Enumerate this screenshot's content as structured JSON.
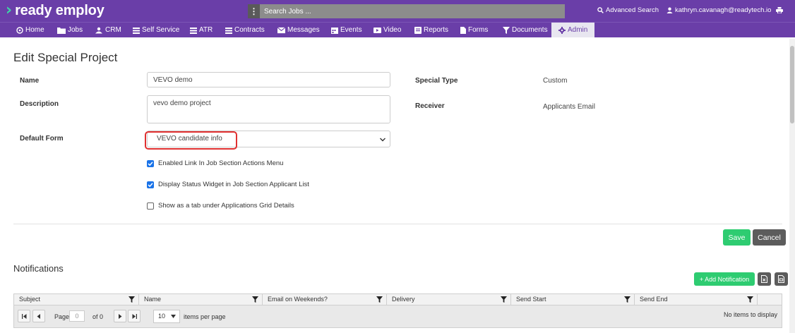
{
  "app": {
    "logo_text": "ready employ",
    "search_placeholder": "Search Jobs ...",
    "advanced_search": "Advanced Search",
    "user_email": "kathryn.cavanagh@readytech.io",
    "brand_color": "#6a3ea8",
    "accent_color": "#3fd6a6"
  },
  "nav": {
    "items": [
      {
        "label": "Home",
        "icon": "home-icon"
      },
      {
        "label": "Jobs",
        "icon": "folder-icon"
      },
      {
        "label": "CRM",
        "icon": "users-icon"
      },
      {
        "label": "Self Service",
        "icon": "list-icon"
      },
      {
        "label": "ATR",
        "icon": "list-icon"
      },
      {
        "label": "Contracts",
        "icon": "list-icon"
      },
      {
        "label": "Messages",
        "icon": "envelope-icon"
      },
      {
        "label": "Events",
        "icon": "calendar-icon"
      },
      {
        "label": "Video",
        "icon": "video-icon"
      },
      {
        "label": "Reports",
        "icon": "report-icon"
      },
      {
        "label": "Forms",
        "icon": "file-icon"
      },
      {
        "label": "Documents",
        "icon": "filter-icon"
      },
      {
        "label": "Admin",
        "icon": "gear-icon",
        "active": true
      }
    ]
  },
  "form": {
    "title": "Edit Special Project",
    "name_label": "Name",
    "name_value": "VEVO demo",
    "description_label": "Description",
    "description_value": "vevo demo project",
    "default_form_label": "Default Form",
    "default_form_value": "VEVO candidate info",
    "special_type_label": "Special Type",
    "special_type_value": "Custom",
    "receiver_label": "Receiver",
    "receiver_value": "Applicants Email",
    "checkboxes": [
      {
        "label": "Enabled Link In Job Section Actions Menu",
        "checked": true
      },
      {
        "label": "Display Status Widget in Job Section Applicant List",
        "checked": true
      },
      {
        "label": "Show as a tab under Applications Grid Details",
        "checked": false
      }
    ],
    "save_label": "Save",
    "cancel_label": "Cancel"
  },
  "notifications": {
    "title": "Notifications",
    "add_label": "+ Add Notification",
    "columns": [
      "Subject",
      "Name",
      "Email on Weekends?",
      "Delivery",
      "Send Start",
      "Send End"
    ],
    "pager": {
      "page_label": "Page",
      "page_value": "0",
      "of_label": "of 0",
      "page_size": "10",
      "items_per_page": "items per page",
      "empty_text": "No items to display"
    }
  }
}
